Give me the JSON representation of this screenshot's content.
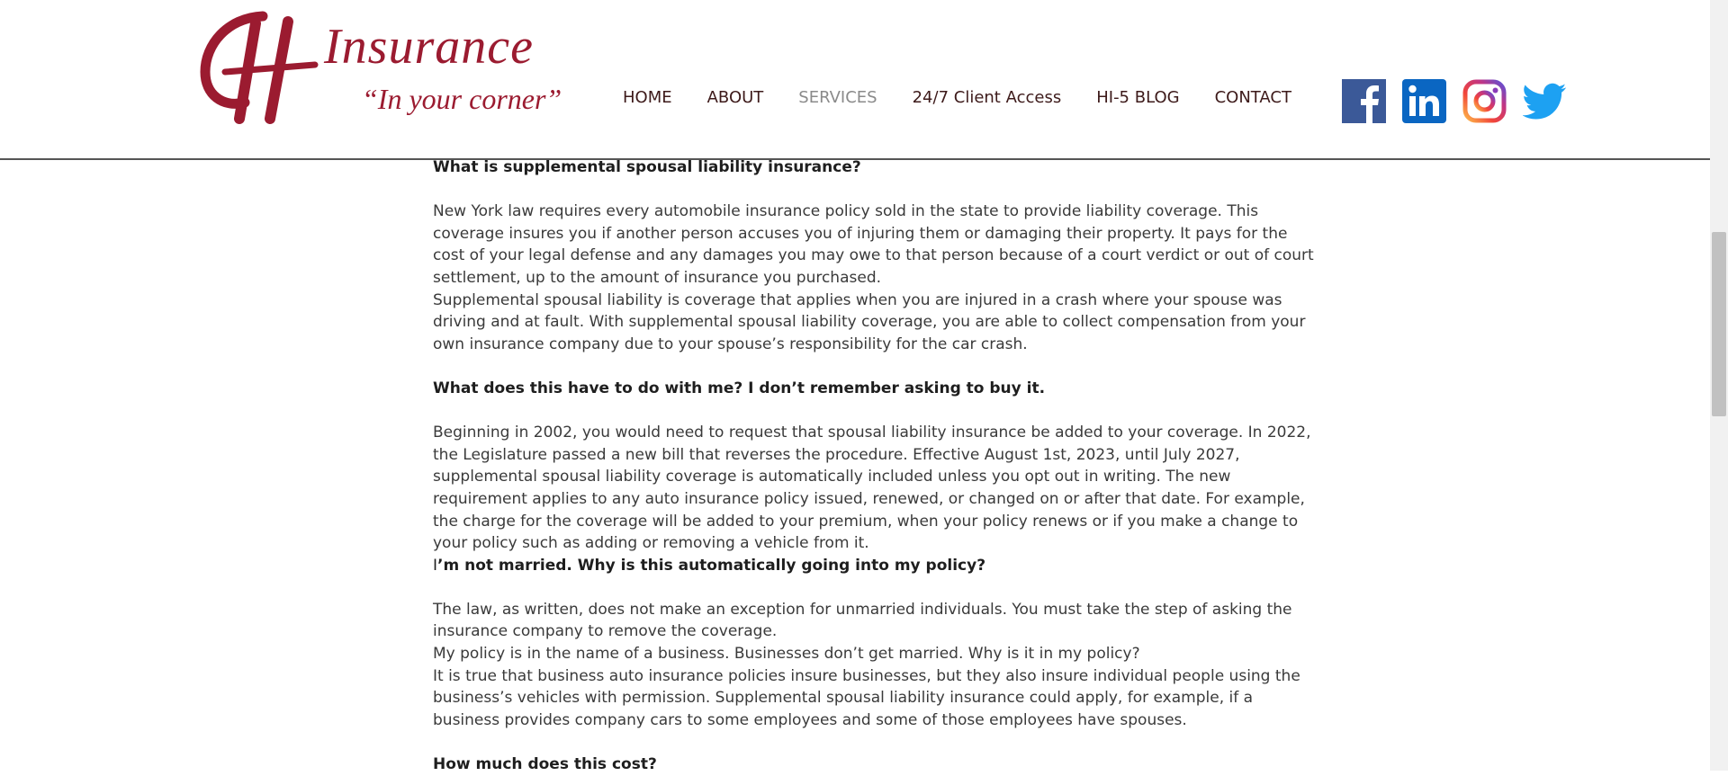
{
  "header": {
    "logo_title": "Insurance",
    "logo_tagline": "“In your corner”",
    "brand_color": "#9b1b30"
  },
  "nav": {
    "items": [
      {
        "label": "HOME",
        "active": false
      },
      {
        "label": "ABOUT",
        "active": false
      },
      {
        "label": "SERVICES",
        "active": true
      },
      {
        "label": "24/7 Client Access",
        "active": false
      },
      {
        "label": "HI-5 BLOG",
        "active": false
      },
      {
        "label": "CONTACT",
        "active": false
      }
    ]
  },
  "social": [
    {
      "icon": "facebook-icon",
      "color": "#3b5998"
    },
    {
      "icon": "linkedin-icon",
      "color": "#0a66c2"
    },
    {
      "icon": "instagram-icon",
      "color": "#c13584"
    },
    {
      "icon": "twitter-icon",
      "color": "#1da1f2"
    }
  ],
  "article": {
    "q1": "What is supplemental spousal liability insurance?",
    "a1_p1": "New York law requires every automobile insurance policy sold in the state to provide liability coverage. This coverage insures you if another person accuses you of injuring them or damaging their property. It pays for the cost of your legal defense and any damages you may owe to that person because of a court verdict or out of court settlement, up to the amount of insurance you purchased.",
    "a1_p2": "Supplemental spousal liability is coverage that applies when you are injured in a crash where your spouse was driving and at fault. With supplemental spousal liability coverage, you are able to collect compensation from your own insurance company due to your spouse’s responsibility for the car crash.",
    "q2": "What does this have to do with me? I don’t remember asking to buy it.",
    "a2": "Beginning in 2002, you would need to request that spousal liability insurance be added to your coverage. In 2022, the Legislature passed a new bill that reverses the procedure. Effective August 1st, 2023, until July 2027, supplemental spousal liability coverage is automatically included unless you opt out in writing. The new requirement applies to any auto insurance policy issued, renewed, or changed on or after that date. For example, the charge for the coverage will be added to your premium, when your policy renews or if you make a change to your policy such as adding or removing a vehicle from it.",
    "q3_lead": "I",
    "q3": "’m not married. Why is this automatically going into my policy?",
    "a3_p1": "The law, as written, does not make an exception for unmarried individuals. You must take the step of asking the insurance company to remove the coverage.",
    "a3_p2": "My policy is in the name of a business. Businesses don’t get married. Why is it in my policy?",
    "a3_p3": "It is true that business auto insurance policies insure businesses, but they also insure individual people using the business’s vehicles with permission. Supplemental spousal liability insurance could apply, for example, if a business provides company cars to some employees and some of those employees have spouses.",
    "q4": "How much does this cost?"
  }
}
